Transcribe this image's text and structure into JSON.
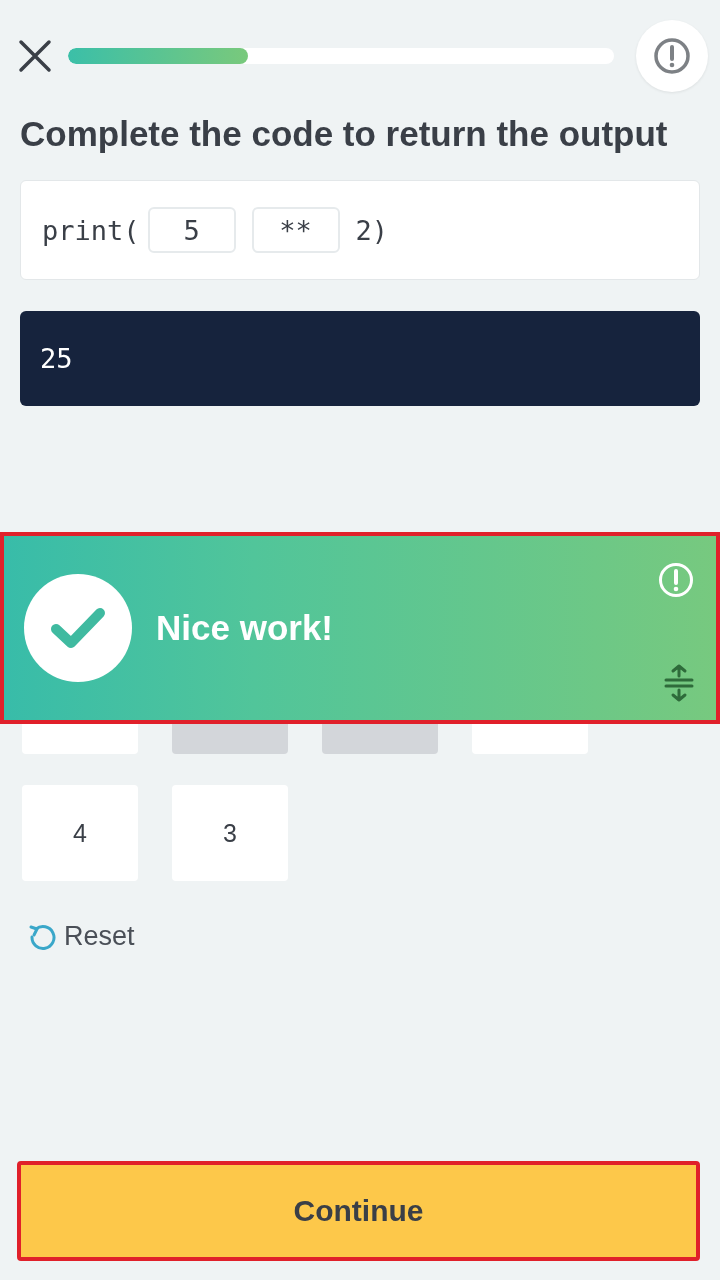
{
  "header": {
    "progress": {
      "level": 0.33
    }
  },
  "title": "Complete the code to return the output",
  "code": [
    {
      "kind": "text",
      "text": "print("
    },
    {
      "kind": "slot",
      "text": "5"
    },
    {
      "kind": "slot",
      "text": "**"
    },
    {
      "kind": "text",
      "text": "2)"
    }
  ],
  "output": "25",
  "tiles": [
    {
      "used": false
    },
    {
      "used": true
    },
    {
      "used": true
    },
    {
      "used": false
    },
    {
      "label": "4",
      "used": false
    },
    {
      "label": "3",
      "used": false
    }
  ],
  "reset": "Reset",
  "banner": {
    "message": "Nice work!",
    "highlighted": true
  },
  "continue_button": {
    "label": "Continue",
    "highlighted": true
  }
}
